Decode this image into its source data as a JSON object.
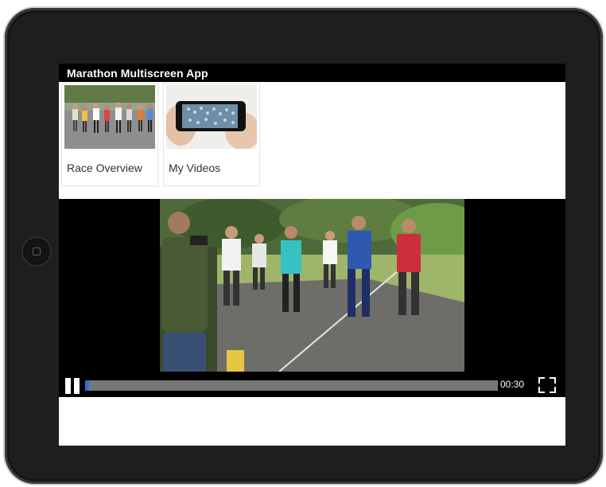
{
  "app": {
    "title": "Marathon Multiscreen App"
  },
  "cards": [
    {
      "label": "Race Overview",
      "image": "marathon-runners-thumbnail"
    },
    {
      "label": "My Videos",
      "image": "phone-recording-thumbnail"
    }
  ],
  "player": {
    "state": "paused",
    "time": "00:30",
    "progress_fraction": 0.01,
    "play_icon": "pause-icon",
    "fullscreen_icon": "fullscreen-icon"
  },
  "colors": {
    "title_bar": "#000000",
    "progress_fill": "#2f6fd6",
    "progress_track": "#777777",
    "device_bezel": "#1e1e1e"
  }
}
